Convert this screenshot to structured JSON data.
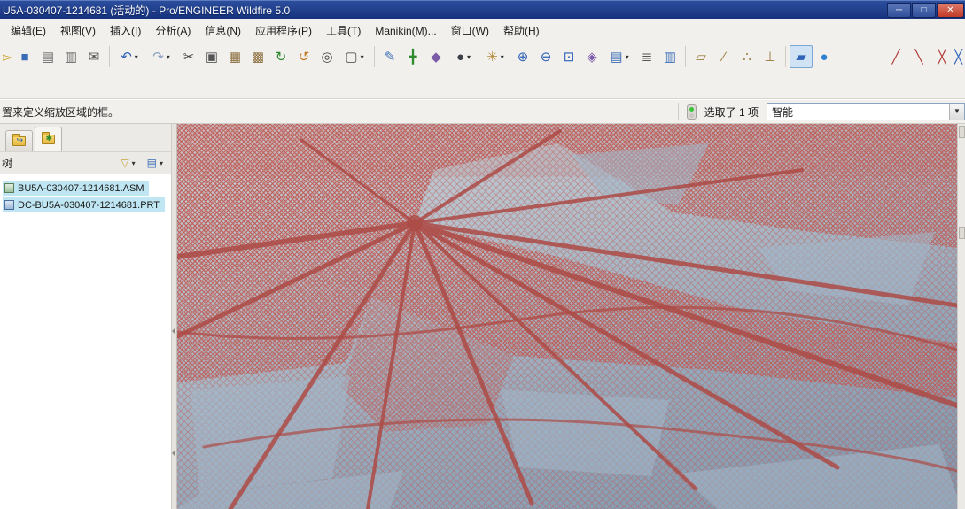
{
  "window": {
    "title": "U5A-030407-1214681 (活动的) - Pro/ENGINEER Wildfire 5.0",
    "controls": {
      "minimize": "─",
      "maximize": "□",
      "close": "✕"
    }
  },
  "menu": {
    "items": [
      "编辑(E)",
      "视图(V)",
      "插入(I)",
      "分析(A)",
      "信息(N)",
      "应用程序(P)",
      "工具(T)",
      "Manikin(M)...",
      "窗口(W)",
      "帮助(H)"
    ]
  },
  "toolbar": {
    "buttons": [
      {
        "name": "open-icon",
        "glyph": "▻",
        "color": "#c9a227",
        "crop": "left"
      },
      {
        "name": "save-icon",
        "glyph": "■",
        "color": "#3a6db5"
      },
      {
        "name": "print-icon",
        "glyph": "▤",
        "color": "#666666"
      },
      {
        "name": "plotter-icon",
        "glyph": "▥",
        "color": "#666666"
      },
      {
        "name": "send-mail-icon",
        "glyph": "✉",
        "color": "#555555"
      },
      {
        "kind": "sep"
      },
      {
        "name": "undo-icon",
        "glyph": "↶",
        "color": "#2f62b8",
        "caret": true
      },
      {
        "name": "redo-icon",
        "glyph": "↷",
        "color": "#8aa0c0",
        "caret": true
      },
      {
        "name": "cut-icon",
        "glyph": "✂",
        "color": "#444444"
      },
      {
        "name": "copy-icon",
        "glyph": "▣",
        "color": "#555555"
      },
      {
        "name": "paste-icon",
        "glyph": "▦",
        "color": "#8a6d3b"
      },
      {
        "name": "paste-special-icon",
        "glyph": "▩",
        "color": "#8a6d3b"
      },
      {
        "name": "regenerate-icon",
        "glyph": "↻",
        "color": "#2e8b2e"
      },
      {
        "name": "auto-regenerate-icon",
        "glyph": "↺",
        "color": "#c07820"
      },
      {
        "name": "find-icon",
        "glyph": "◎",
        "color": "#444444"
      },
      {
        "name": "select-box-icon",
        "glyph": "▢",
        "color": "#555555",
        "caret": true
      },
      {
        "kind": "sep"
      },
      {
        "name": "repaint-icon",
        "glyph": "✎",
        "color": "#3a6db5"
      },
      {
        "name": "spin-center-icon",
        "glyph": "╋",
        "color": "#2e8b2e"
      },
      {
        "name": "orient-mode-icon",
        "glyph": "◆",
        "color": "#7a5ca8"
      },
      {
        "name": "display-style-icon",
        "glyph": "●",
        "color": "#3b3f46",
        "caret": true
      },
      {
        "name": "spin-pan-zoom-icon",
        "glyph": "✳",
        "color": "#b5893a",
        "caret": true
      },
      {
        "name": "zoom-in-icon",
        "glyph": "⊕",
        "color": "#2f62b8"
      },
      {
        "name": "zoom-out-icon",
        "glyph": "⊖",
        "color": "#2f62b8"
      },
      {
        "name": "refit-icon",
        "glyph": "⊡",
        "color": "#2f62b8"
      },
      {
        "name": "reorient-icon",
        "glyph": "◈",
        "color": "#7a5ca8"
      },
      {
        "name": "saved-views-icon",
        "glyph": "▤",
        "color": "#3a6db5",
        "caret": true
      },
      {
        "name": "layers-icon",
        "glyph": "≣",
        "color": "#555555"
      },
      {
        "name": "view-manager-icon",
        "glyph": "▥",
        "color": "#3a6db5"
      },
      {
        "kind": "sep"
      },
      {
        "name": "datum-planes-icon",
        "glyph": "▱",
        "color": "#9a7b3c"
      },
      {
        "name": "datum-axes-icon",
        "glyph": "∕",
        "color": "#9a7b3c"
      },
      {
        "name": "datum-points-icon",
        "glyph": "∴",
        "color": "#9a7b3c"
      },
      {
        "name": "datum-csys-icon",
        "glyph": "⊥",
        "color": "#9a7b3c"
      },
      {
        "kind": "sep"
      },
      {
        "name": "annotation-display-toggle-icon",
        "glyph": "▰",
        "color": "#2f62b8",
        "active": true
      },
      {
        "name": "spin-center-ball-icon",
        "glyph": "●",
        "color": "#2f7fd0"
      },
      {
        "kind": "gap"
      },
      {
        "name": "sketch-line-icon",
        "glyph": "╱",
        "color": "#b03a36"
      },
      {
        "name": "sketch-centerline-icon",
        "glyph": "╲",
        "color": "#b03a36"
      },
      {
        "name": "highlight-endpoints-icon",
        "glyph": "╳",
        "color": "#b03a36"
      },
      {
        "name": "overlap-geometry-icon",
        "glyph": "╳",
        "color": "#2f62b8",
        "crop": "right"
      }
    ]
  },
  "messagebar": {
    "message": "置来定义缩放区域的框。",
    "selection_status": "选取了 1 项",
    "filter_value": "智能"
  },
  "navigator": {
    "tabs": [
      {
        "name": "tab-folder-browser",
        "badge": "↪",
        "badge_kind": "arrow"
      },
      {
        "name": "tab-favorites",
        "badge": "✱",
        "badge_kind": "star",
        "active": true
      }
    ],
    "tree_header": {
      "title": "树",
      "buttons": [
        {
          "name": "show-menu-button",
          "glyph": "▽"
        },
        {
          "name": "settings-menu-button",
          "glyph": "▤"
        }
      ]
    },
    "tree_items": [
      {
        "label": "BU5A-030407-1214681.ASM",
        "type": "asm"
      },
      {
        "label": "DC-BU5A-030407-1214681.PRT",
        "type": "prt"
      }
    ]
  },
  "colors": {
    "titlebar_blue": "#16317c",
    "selection_highlight": "#bfe6f2",
    "mesh_red": "#c05a53",
    "ridge_red": "#ad4b46",
    "viewport_top": "#ccd1d7",
    "viewport_bottom": "#7e96ac"
  }
}
